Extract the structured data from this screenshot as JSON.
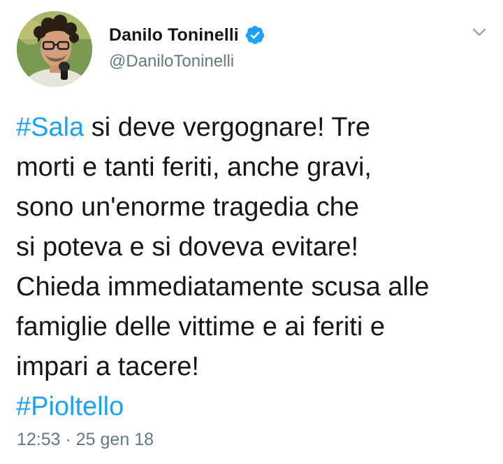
{
  "author": {
    "name": "Danilo Toninelli",
    "handle": "@DaniloToninelli",
    "verified": true
  },
  "icons": {
    "verified": "verified-badge-icon",
    "menu": "chevron-down-icon",
    "avatar": "profile-photo"
  },
  "colors": {
    "link": "#1da1f2",
    "text": "#14171a",
    "secondary": "#657786"
  },
  "tweet": {
    "hashtag_sala": "#Sala",
    "line1_rest": " si deve vergognare! Tre",
    "line2": "morti e tanti feriti, anche gravi,",
    "line3": "sono un'enorme tragedia che",
    "line4": "si poteva e si doveva evitare!",
    "line5": "Chieda immediatamente scusa alle",
    "line6": "famiglie delle vittime e ai feriti e",
    "line7": "impari a tacere!",
    "hashtag_pioltello": "#Pioltello"
  },
  "timestamp": "12:53 · 25 gen 18"
}
